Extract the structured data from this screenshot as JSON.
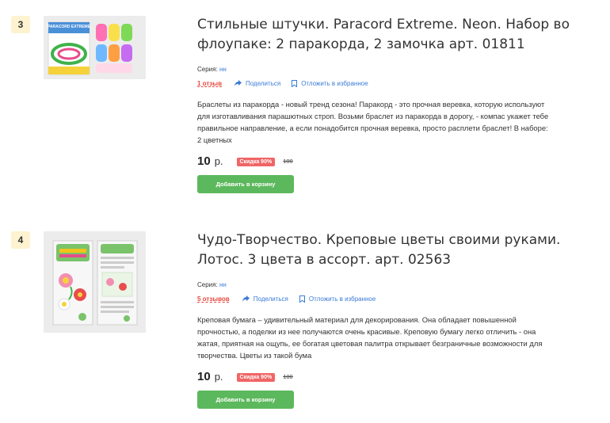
{
  "products": [
    {
      "number": "3",
      "title": "Стильные штучки. Paracord Extreme. Neon. Набор во флоупаке: 2 паракорда, 2 замочка арт. 01811",
      "series_label": "Серия:",
      "series_value": "нн",
      "reviews": "1 отзыв",
      "share": "Поделиться",
      "favorite": "Отложить в избранное",
      "description": "Браслеты из паракорда - новый тренд сезона! Паракорд - это прочная веревка, которую используют для изготавливания парашютных строп. Возьми браслет из паракорда в дорогу, - компас укажет тебе правильное направление, а если понадобится прочная веревка, просто расплети браслет! В наборе: 2 цветных",
      "price": "10",
      "currency": "р.",
      "discount": "Скидка 90%",
      "old_price": "100",
      "add_to_cart": "Добавить в корзину",
      "image_text": "PARACORD EXTREME"
    },
    {
      "number": "4",
      "title": "Чудо-Творчество. Креповые цветы своими руками. Лотос. 3 цвета в ассорт. арт. 02563",
      "series_label": "Серия:",
      "series_value": "нн",
      "reviews": "5 отзывов",
      "share": "Поделиться",
      "favorite": "Отложить в избранное",
      "description": "Креповая бумага – удивительный материал для декорирования. Она обладает повышенной прочностью, а поделки из нее получаются очень красивые. Креповую бумагу легко отличить - она жатая, приятная на ощупь, ее богатая цветовая палитра открывает безграничные возможности для творчества. Цветы из такой бума",
      "price": "10",
      "currency": "р.",
      "discount": "Скидка 90%",
      "old_price": "100",
      "add_to_cart": "Добавить в корзину"
    }
  ],
  "colors": {
    "badge_bg": "#fdf3d0",
    "link_blue": "#3a7bd5",
    "review_red": "#e8473f",
    "discount_red": "#f06565",
    "button_green": "#5cb85c"
  }
}
